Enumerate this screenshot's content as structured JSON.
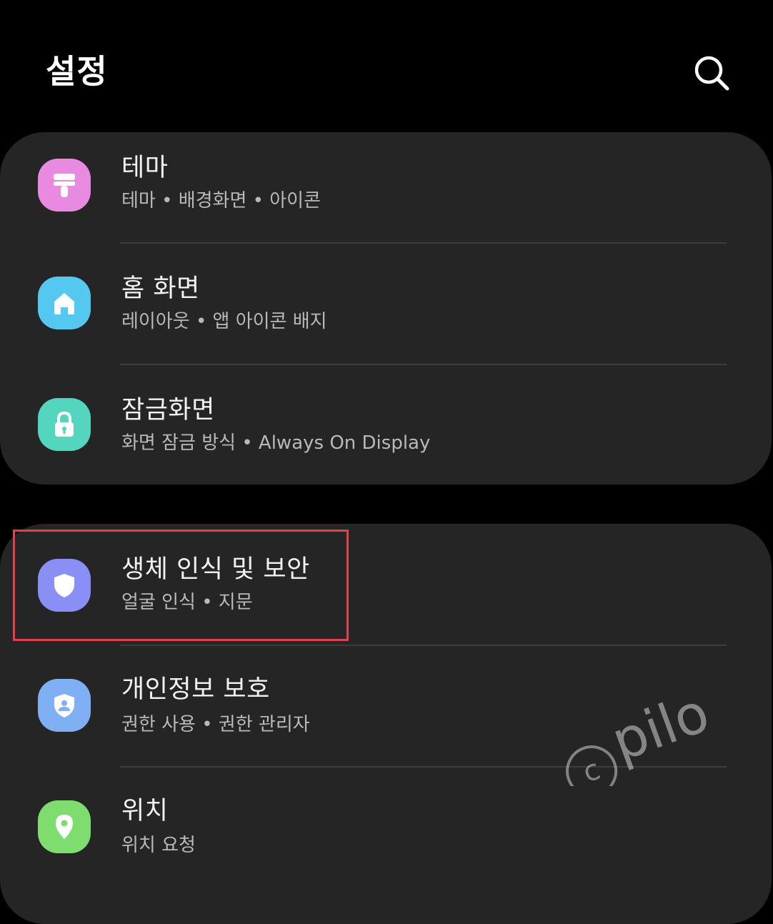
{
  "header": {
    "title": "설정",
    "search_icon": "search-icon"
  },
  "groups": [
    {
      "items": [
        {
          "title": "테마",
          "subtitle": "테마  •  배경화면  •  아이콘",
          "icon": "paint-brush-icon",
          "icon_color": "#e88be0"
        },
        {
          "title": "홈 화면",
          "subtitle": "레이아웃  •  앱 아이콘 배지",
          "icon": "home-icon",
          "icon_color": "#54c8f0"
        },
        {
          "title": "잠금화면",
          "subtitle": "화면 잠금 방식  •  Always On Display",
          "icon": "lock-icon",
          "icon_color": "#53d6bd"
        }
      ]
    },
    {
      "items": [
        {
          "title": "생체 인식 및 보안",
          "subtitle": "얼굴 인식  •  지문",
          "icon": "shield-icon",
          "icon_color": "#8a8ff5"
        },
        {
          "title": "개인정보 보호",
          "subtitle": "권한 사용  •  권한 관리자",
          "icon": "privacy-shield-icon",
          "icon_color": "#7fb0f3"
        },
        {
          "title": "위치",
          "subtitle": "위치 요청",
          "icon": "location-pin-icon",
          "icon_color": "#7fdc6e"
        }
      ]
    }
  ],
  "highlight_color": "#e2404a",
  "watermark": "pilo"
}
